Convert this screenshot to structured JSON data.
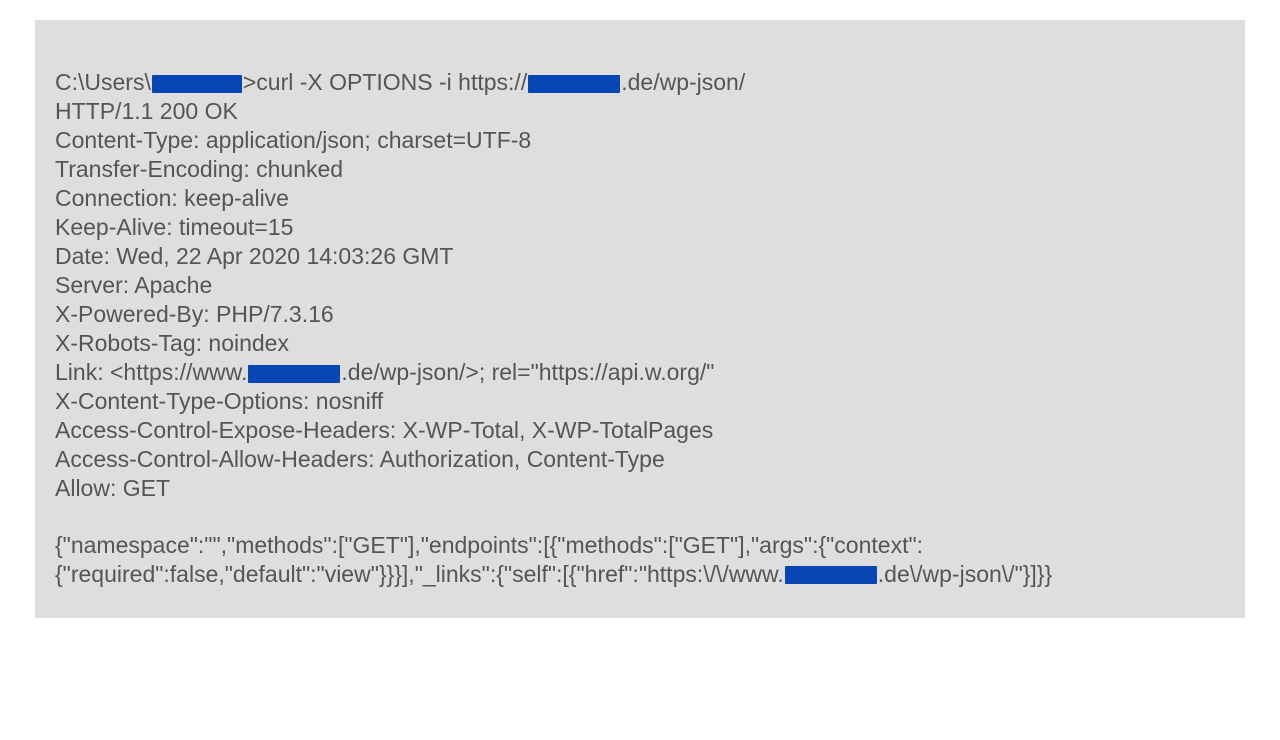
{
  "cmd": {
    "pathPrefix": "C:\\Users\\",
    "pathSuffix": ">curl  -X OPTIONS -i https://",
    "urlSuffix": ".de/wp-json/"
  },
  "headers": {
    "status": "HTTP/1.1 200 OK",
    "contentType": "Content-Type: application/json; charset=UTF-8",
    "transferEncoding": "Transfer-Encoding: chunked",
    "connection": "Connection: keep-alive",
    "keepAlive": "Keep-Alive: timeout=15",
    "date": "Date: Wed, 22 Apr 2020 14:03:26 GMT",
    "server": "Server: Apache",
    "poweredBy": "X-Powered-By: PHP/7.3.16",
    "robots": "X-Robots-Tag: noindex",
    "linkPre": "Link: <https://www.",
    "linkPost": ".de/wp-json/>; rel=\"https://api.w.org/\"",
    "xcto": "X-Content-Type-Options: nosniff",
    "aceh": "Access-Control-Expose-Headers:  X-WP-Total, X-WP-TotalPages",
    "acah": "Access-Control-Allow-Headers:  Authorization, Content-Type",
    "allow": "Allow: GET"
  },
  "body": {
    "part1": "{\"namespace\":\"\",\"methods\":[\"GET\"],\"endpoints\":[{\"methods\":[\"GET\"],\"args\":{\"context\":{\"required\":false,\"default\":\"view\"}}}],\"_links\":{\"self\":[{\"href\":\"https:\\/\\/www.",
    "part2": ".de\\/wp-json\\/\"}]}}"
  }
}
